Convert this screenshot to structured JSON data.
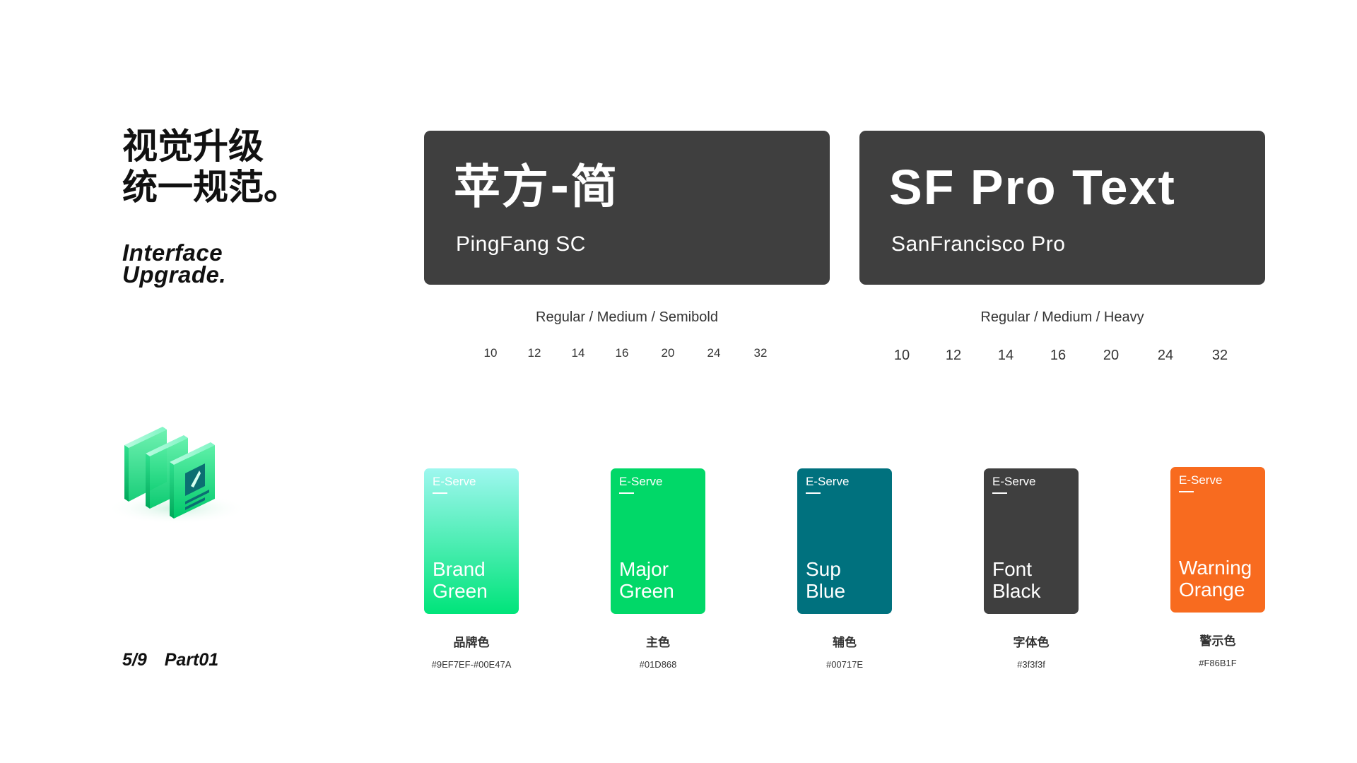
{
  "heading": {
    "cn_line1": "视觉升级",
    "cn_line2": "统一规范。",
    "en_line1": "Interface",
    "en_line2": "Upgrade."
  },
  "illustration": {
    "icon": "books-icon"
  },
  "page_indicator": {
    "page": "5/9",
    "part": "Part01"
  },
  "fonts": {
    "pingfang": {
      "name": "苹方-简",
      "sub": "PingFang SC",
      "weights": "Regular  /  Medium  /  Semibold",
      "sizes": [
        "10",
        "12",
        "14",
        "16",
        "20",
        "24",
        "32"
      ]
    },
    "sf": {
      "name": "SF Pro Text",
      "sub": "SanFrancisco Pro",
      "weights": "Regular  /  Medium  /  Heavy",
      "sizes": [
        "10",
        "12",
        "14",
        "16",
        "20",
        "24",
        "32"
      ]
    }
  },
  "swatches": [
    {
      "brand": "E-Serve",
      "line1": "Brand",
      "line2": "Green",
      "cn": "品牌色",
      "hex": "#9EF7EF-#00E47A",
      "color_start": "#9EF7EF",
      "color_end": "#00E47A"
    },
    {
      "brand": "E-Serve",
      "line1": "Major",
      "line2": "Green",
      "cn": "主色",
      "hex": "#01D868",
      "color": "#01D868"
    },
    {
      "brand": "E-Serve",
      "line1": "Sup",
      "line2": "Blue",
      "cn": "辅色",
      "hex": "#00717E",
      "color": "#00717E"
    },
    {
      "brand": "E-Serve",
      "line1": "Font",
      "line2": "Black",
      "cn": "字体色",
      "hex": "#3f3f3f",
      "color": "#3f3f3f"
    },
    {
      "brand": "E-Serve",
      "line1": "Warning",
      "line2": "Orange",
      "cn": "警示色",
      "hex": "#F86B1F",
      "color": "#F86B1F"
    }
  ]
}
